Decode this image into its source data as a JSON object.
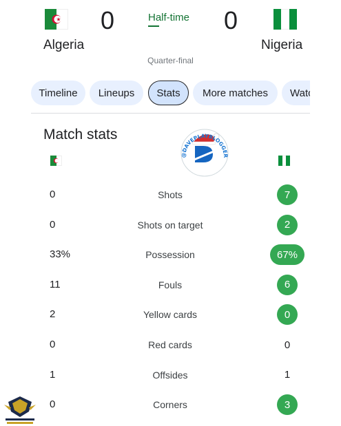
{
  "match": {
    "home": {
      "name": "Algeria",
      "score": "0"
    },
    "away": {
      "name": "Nigeria",
      "score": "0"
    },
    "status": "Half-time",
    "stage": "Quarter-final"
  },
  "tabs": [
    {
      "label": "Timeline",
      "active": false
    },
    {
      "label": "Lineups",
      "active": false
    },
    {
      "label": "Stats",
      "active": true
    },
    {
      "label": "More matches",
      "active": false
    },
    {
      "label": "Watch",
      "active": false
    }
  ],
  "stats": {
    "title": "Match stats",
    "rows": [
      {
        "label": "Shots",
        "home": "0",
        "away": "7",
        "away_leads": true
      },
      {
        "label": "Shots on target",
        "home": "0",
        "away": "2",
        "away_leads": true
      },
      {
        "label": "Possession",
        "home": "33%",
        "away": "67%",
        "away_leads": true
      },
      {
        "label": "Fouls",
        "home": "11",
        "away": "6",
        "away_leads": true
      },
      {
        "label": "Yellow cards",
        "home": "2",
        "away": "0",
        "away_leads": true
      },
      {
        "label": "Red cards",
        "home": "0",
        "away": "0",
        "away_leads": false
      },
      {
        "label": "Offsides",
        "home": "1",
        "away": "1",
        "away_leads": false
      },
      {
        "label": "Corners",
        "home": "0",
        "away": "3",
        "away_leads": true
      }
    ]
  },
  "watermark": {
    "text": "@DAVEPLAYBLOGGER"
  },
  "colors": {
    "accent_green": "#34a853",
    "status_green": "#137333",
    "tab_bg": "#e8f0fe"
  }
}
